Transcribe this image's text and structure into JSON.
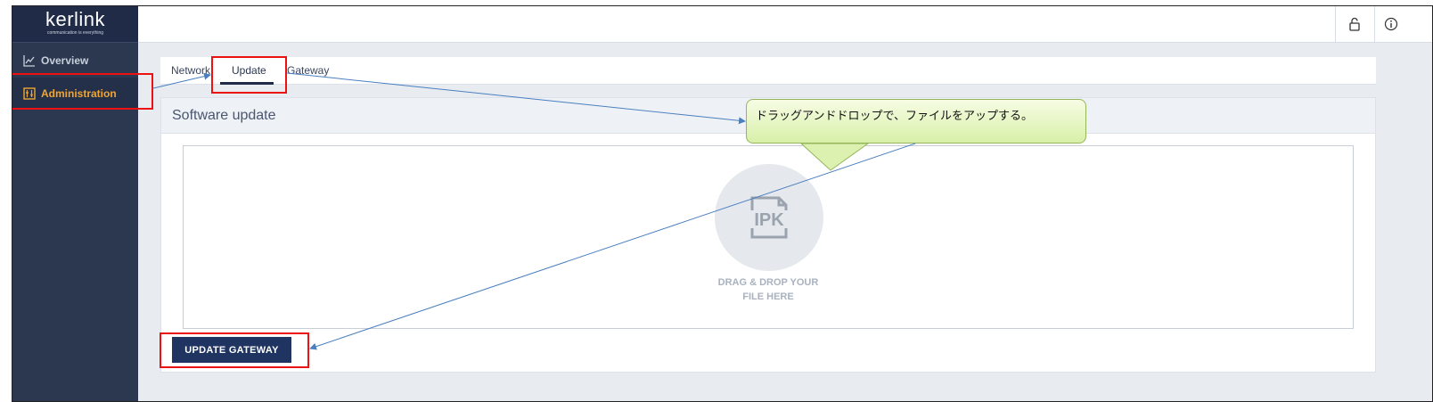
{
  "sidebar": {
    "logo_brand": "kerlink",
    "logo_tagline": "communication is everything",
    "items": [
      {
        "label": "Overview",
        "icon": "chart-line-icon",
        "active": false
      },
      {
        "label": "Administration",
        "icon": "settings-panel-icon",
        "active": true
      }
    ]
  },
  "topbar": {
    "icons": [
      "lock-icon",
      "info-icon"
    ]
  },
  "tabs": [
    {
      "label": "Network"
    },
    {
      "label": "Update",
      "active": true
    },
    {
      "label": "Gateway"
    }
  ],
  "card": {
    "title": "Software update",
    "dropzone": {
      "icon_label": "IPK",
      "text_line1": "DRAG & DROP YOUR",
      "text_line2": "FILE HERE"
    },
    "button_label": "UPDATE GATEWAY"
  },
  "callout": {
    "text": "ドラッグアンドドロップで、ファイルをアップする。"
  },
  "colors": {
    "sidebar_bg": "#2c3850",
    "accent": "#f0a531",
    "button_bg": "#1f3460",
    "highlight": "#ee1111",
    "arrow": "#4a7fc0"
  }
}
